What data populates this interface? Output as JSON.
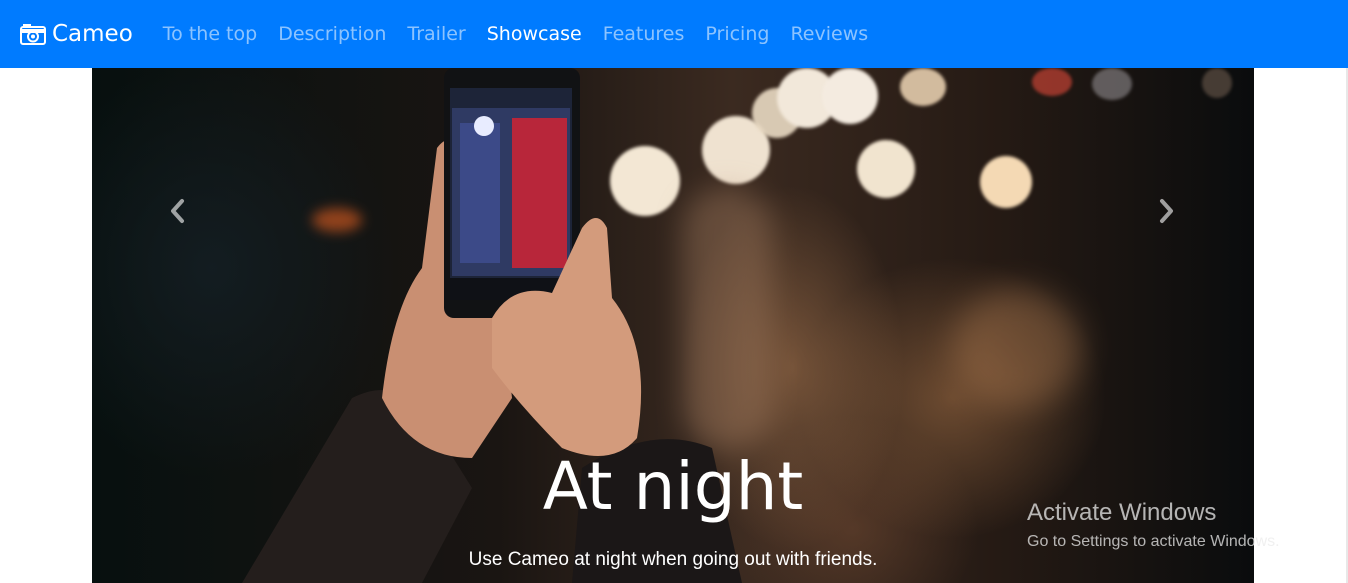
{
  "navbar": {
    "brand": "Cameo",
    "brand_icon": "camera-icon",
    "background": "#007bff",
    "items": [
      {
        "label": "To the top",
        "active": false
      },
      {
        "label": "Description",
        "active": false
      },
      {
        "label": "Trailer",
        "active": false
      },
      {
        "label": "Showcase",
        "active": true
      },
      {
        "label": "Features",
        "active": false
      },
      {
        "label": "Pricing",
        "active": false
      },
      {
        "label": "Reviews",
        "active": false
      }
    ]
  },
  "carousel": {
    "prev_icon": "chevron-left-icon",
    "next_icon": "chevron-right-icon",
    "slide": {
      "title": "At night",
      "text": "Use Cameo at night when going out with friends."
    }
  },
  "watermark": {
    "title": "Activate Windows",
    "subtitle": "Go to Settings to activate Windows."
  }
}
